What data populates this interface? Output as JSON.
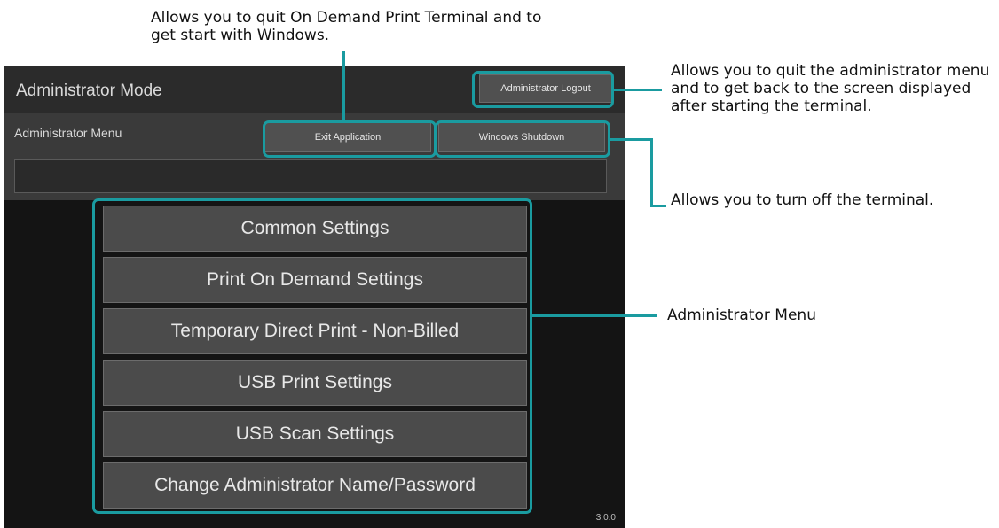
{
  "screen": {
    "title": "Administrator Mode",
    "logout_button": "Administrator Logout",
    "submenu_label": "Administrator Menu",
    "exit_button": "Exit Application",
    "shutdown_button": "Windows Shutdown",
    "version": "3.0.0",
    "menu_items": [
      {
        "label": "Common Settings"
      },
      {
        "label": "Print On Demand Settings"
      },
      {
        "label": "Temporary Direct Print - Non-Billed"
      },
      {
        "label": "USB Print Settings"
      },
      {
        "label": "USB Scan Settings"
      },
      {
        "label": "Change Administrator Name/Password"
      }
    ]
  },
  "callouts": {
    "exit": "Allows you to quit On Demand Print Terminal and to get start with Windows.",
    "logout": "Allows you to quit the administrator menu and to get back to the screen displayed after starting the terminal.",
    "shutdown": "Allows you to turn off the terminal.",
    "menu": "Administrator Menu"
  },
  "colors": {
    "accent": "#1a9ba0",
    "screen_bg": "#141414",
    "button_bg": "#4b4b4b"
  }
}
